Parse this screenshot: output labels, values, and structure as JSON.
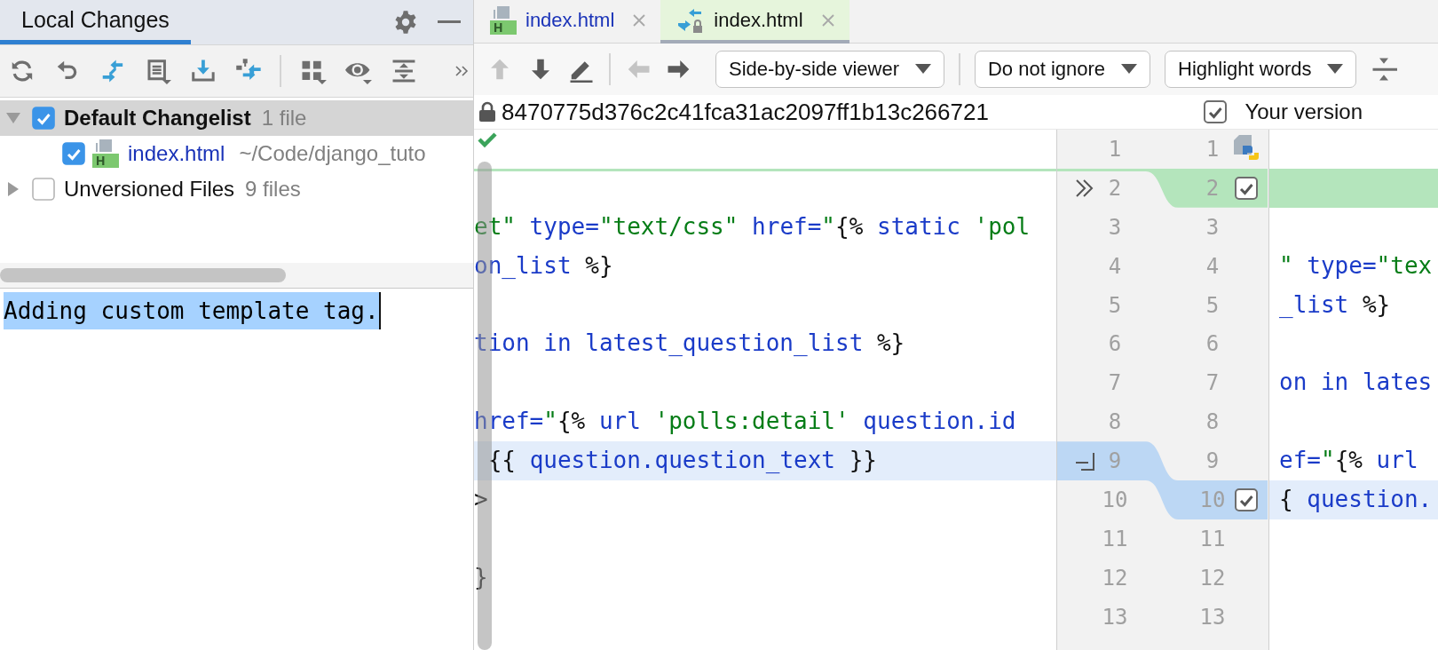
{
  "tool_window": {
    "tabs": [
      {
        "label": "Local Changes",
        "selected": true
      }
    ]
  },
  "changes_tree": [
    {
      "kind": "changelist",
      "label": "Default Changelist",
      "count": "1 file",
      "checked": true,
      "expanded": true,
      "selected": true,
      "children": [
        {
          "kind": "file",
          "label": "index.html",
          "path": "~/Code/django_tuto",
          "checked": true,
          "selected": false
        }
      ]
    },
    {
      "kind": "group",
      "label": "Unversioned Files",
      "count": "9 files",
      "checked": false,
      "expanded": false,
      "selected": false
    }
  ],
  "commit_message": {
    "value": "Adding custom template tag.",
    "selected": true
  },
  "editor_tabs": [
    {
      "label": "index.html",
      "kind": "file",
      "modified": true,
      "selected": false
    },
    {
      "label": "index.html",
      "kind": "diff",
      "modified": false,
      "selected": true
    }
  ],
  "diff_toolbar": {
    "buttons": [
      {
        "disabled": true
      },
      {
        "disabled": false
      },
      {
        "disabled": false
      },
      {
        "disabled": true
      },
      {
        "disabled": false
      }
    ],
    "dropdowns": [
      "Side-by-side viewer",
      "Do not ignore",
      "Highlight words"
    ]
  },
  "diff": {
    "left_title": "8470775d376c2c41fca31ac2097ff1b13c266721",
    "right_title": {
      "label": "Your version",
      "checked": true
    },
    "left_lines": [
      {
        "kind": "plain"
      },
      {
        "kind": "insertion_point"
      },
      {
        "kind": "plain",
        "tokens": [
          {
            "kind": "string",
            "text": "et\""
          },
          {
            "kind": "tag",
            "text": " type="
          },
          {
            "kind": "string",
            "text": "\"text/css\""
          },
          {
            "kind": "tag",
            "text": " href="
          },
          {
            "kind": "string",
            "text": "\""
          },
          {
            "kind": "plain",
            "text": "{%"
          },
          {
            "kind": "tag",
            "text": " static "
          },
          {
            "kind": "string",
            "text": "'pol"
          }
        ]
      },
      {
        "kind": "plain",
        "tokens": [
          {
            "kind": "tag",
            "text": "on_list"
          },
          {
            "kind": "plain",
            "text": " %}"
          }
        ]
      },
      {
        "kind": "plain"
      },
      {
        "kind": "plain",
        "tokens": [
          {
            "kind": "tag",
            "text": "tion in latest_question_list"
          },
          {
            "kind": "plain",
            "text": " %}"
          }
        ]
      },
      {
        "kind": "plain"
      },
      {
        "kind": "plain",
        "tokens": [
          {
            "kind": "tag",
            "text": "href="
          },
          {
            "kind": "string",
            "text": "\""
          },
          {
            "kind": "plain",
            "text": "{%"
          },
          {
            "kind": "tag",
            "text": " url "
          },
          {
            "kind": "string",
            "text": "'polls:detail'"
          },
          {
            "kind": "tag",
            "text": " question.id"
          }
        ]
      },
      {
        "kind": "modified",
        "tokens": [
          {
            "kind": "plain",
            "text": " {{ "
          },
          {
            "kind": "tag",
            "text": "question.question_text"
          },
          {
            "kind": "plain",
            "text": " }}"
          }
        ]
      },
      {
        "kind": "plain",
        "tokens": [
          {
            "kind": "plain",
            "text": ">"
          }
        ]
      },
      {
        "kind": "plain"
      },
      {
        "kind": "plain",
        "tokens": [
          {
            "kind": "plain",
            "text": "}"
          }
        ]
      },
      {
        "kind": "plain"
      }
    ],
    "gutter": [
      {
        "kind": "file_type",
        "old_number": "1",
        "new_number": "1"
      },
      {
        "kind": "apply",
        "old_number": "2",
        "new_number": "2",
        "checked": true
      },
      {
        "kind": "plain",
        "old_number": "3",
        "new_number": "3"
      },
      {
        "kind": "plain",
        "old_number": "4",
        "new_number": "4"
      },
      {
        "kind": "plain",
        "old_number": "5",
        "new_number": "5"
      },
      {
        "kind": "plain",
        "old_number": "6",
        "new_number": "6"
      },
      {
        "kind": "plain",
        "old_number": "7",
        "new_number": "7"
      },
      {
        "kind": "plain",
        "old_number": "8",
        "new_number": "8"
      },
      {
        "kind": "append",
        "old_number": "9",
        "new_number": "9"
      },
      {
        "kind": "plain",
        "old_number": "10",
        "new_number": "10",
        "checked": true
      },
      {
        "kind": "plain",
        "old_number": "11",
        "new_number": "11"
      },
      {
        "kind": "plain",
        "old_number": "12",
        "new_number": "12"
      },
      {
        "kind": "plain",
        "old_number": "13",
        "new_number": "13"
      }
    ],
    "right_lines": [
      {
        "kind": "plain"
      },
      {
        "kind": "inserted"
      },
      {
        "kind": "plain"
      },
      {
        "kind": "plain",
        "tokens": [
          {
            "kind": "string",
            "text": "\""
          },
          {
            "kind": "tag",
            "text": " type="
          },
          {
            "kind": "string",
            "text": "\"tex"
          }
        ]
      },
      {
        "kind": "plain",
        "tokens": [
          {
            "kind": "tag",
            "text": "_list"
          },
          {
            "kind": "plain",
            "text": " %}"
          }
        ]
      },
      {
        "kind": "plain"
      },
      {
        "kind": "plain",
        "tokens": [
          {
            "kind": "tag",
            "text": "on in lates"
          }
        ]
      },
      {
        "kind": "plain"
      },
      {
        "kind": "plain",
        "tokens": [
          {
            "kind": "tag",
            "text": "ef="
          },
          {
            "kind": "string",
            "text": "\""
          },
          {
            "kind": "plain",
            "text": "{%"
          },
          {
            "kind": "tag",
            "text": " url"
          }
        ]
      },
      {
        "kind": "modified",
        "tokens": [
          {
            "kind": "plain",
            "text": "{ "
          },
          {
            "kind": "tag",
            "text": "question."
          }
        ]
      },
      {
        "kind": "plain"
      },
      {
        "kind": "plain"
      },
      {
        "kind": "plain"
      }
    ]
  }
}
